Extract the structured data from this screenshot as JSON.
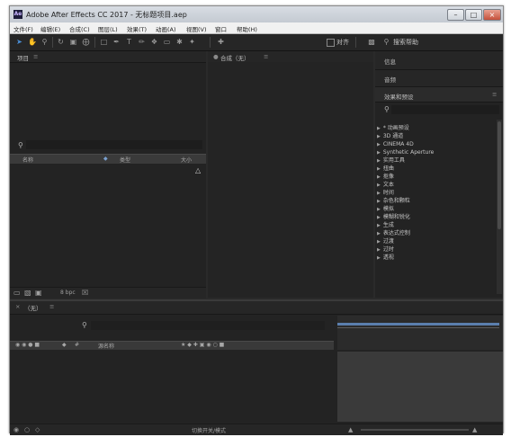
{
  "window": {
    "title": "Adobe After Effects CC 2017 - 无标题项目.aep",
    "logo": "Ae"
  },
  "menu": [
    "文件(F)",
    "编辑(E)",
    "合成(C)",
    "图层(L)",
    "效果(T)",
    "动画(A)",
    "视图(V)",
    "窗口",
    "帮助(H)"
  ],
  "toolbar": {
    "tools": [
      "selection-tool",
      "hand-tool",
      "zoom-tool",
      "rotate-tool",
      "camera-tool",
      "pan-behind-tool",
      "rectangle-tool",
      "pen-tool",
      "text-tool",
      "brush-tool",
      "clone-stamp-tool",
      "eraser-tool",
      "roto-brush-tool",
      "puppet-tool"
    ],
    "snap_label": "对齐",
    "search_help_label": "搜索帮助"
  },
  "project_panel": {
    "title": "项目",
    "columns": [
      "名称",
      "类型",
      "大小"
    ],
    "bpc_label": "8 bpc"
  },
  "composition_panel": {
    "title": "合成（无）"
  },
  "right_panel": {
    "info_tab": "信息",
    "audio_tab": "音频",
    "effects_title": "效果和预设",
    "effects": [
      "* 动画预设",
      "3D 通道",
      "CINEMA 4D",
      "Synthetic Aperture",
      "实用工具",
      "扭曲",
      "抠像",
      "文本",
      "时间",
      "杂色和颗粒",
      "模拟",
      "模糊和锐化",
      "生成",
      "表达式控制",
      "过渡",
      "过时",
      "透视"
    ]
  },
  "timeline_panel": {
    "title": "（无）",
    "layer_name_label": "源名称",
    "footer_label": "切换开关/模式"
  }
}
